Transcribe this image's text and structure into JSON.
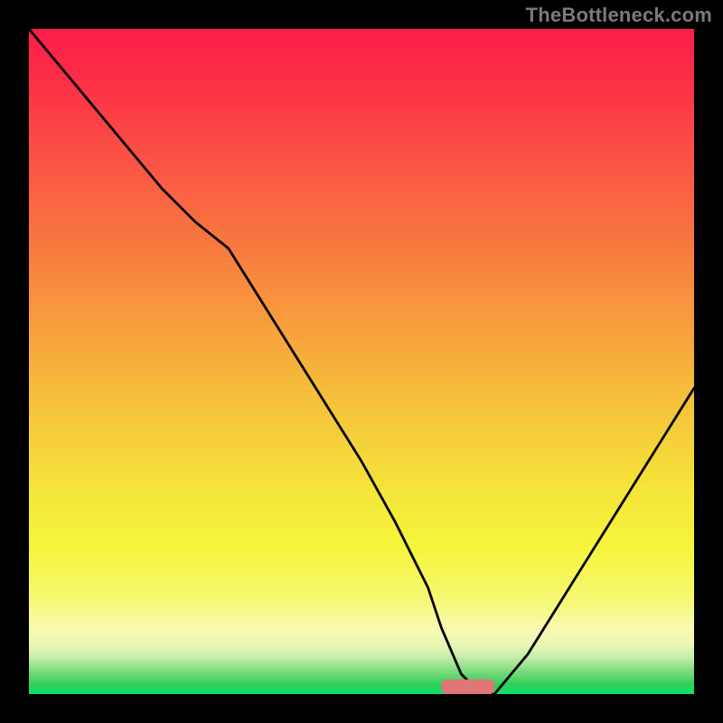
{
  "attribution": "TheBottleneck.com",
  "chart_data": {
    "type": "line",
    "title": "",
    "xlabel": "",
    "ylabel": "",
    "xlim": [
      0,
      100
    ],
    "ylim": [
      0,
      100
    ],
    "background_gradient": {
      "stops": [
        {
          "offset": 0.0,
          "color": "#fb1d47"
        },
        {
          "offset": 0.06,
          "color": "#fc2a47"
        },
        {
          "offset": 0.14,
          "color": "#fb4245"
        },
        {
          "offset": 0.22,
          "color": "#fa5a43"
        },
        {
          "offset": 0.3,
          "color": "#f87140"
        },
        {
          "offset": 0.38,
          "color": "#f88a3e"
        },
        {
          "offset": 0.46,
          "color": "#f7a33d"
        },
        {
          "offset": 0.54,
          "color": "#f6bc3b"
        },
        {
          "offset": 0.62,
          "color": "#f5d13a"
        },
        {
          "offset": 0.7,
          "color": "#f5e63a"
        },
        {
          "offset": 0.78,
          "color": "#f5f53a"
        },
        {
          "offset": 0.86,
          "color": "#f6f876"
        },
        {
          "offset": 0.9,
          "color": "#f9fab1"
        },
        {
          "offset": 0.925,
          "color": "#ecf7b6"
        },
        {
          "offset": 0.945,
          "color": "#c5ecaa"
        },
        {
          "offset": 0.965,
          "color": "#7fdb7f"
        },
        {
          "offset": 0.985,
          "color": "#34cf58"
        },
        {
          "offset": 1.0,
          "color": "#08e26d"
        }
      ]
    },
    "series": [
      {
        "name": "bottleneck-curve",
        "x": [
          0,
          5,
          10,
          15,
          20,
          25,
          30,
          35,
          40,
          45,
          50,
          55,
          60,
          62,
          65,
          68,
          70,
          75,
          80,
          85,
          90,
          95,
          100
        ],
        "y": [
          100,
          94,
          88,
          82,
          76,
          71,
          67,
          59,
          51,
          43,
          35,
          26,
          16,
          10,
          3,
          0,
          0,
          6,
          14,
          22,
          30,
          38,
          46
        ]
      }
    ],
    "marker": {
      "name": "optimal-range",
      "x_center": 66,
      "y": 0,
      "width": 8,
      "height": 2.2,
      "color": "#e07676"
    }
  }
}
